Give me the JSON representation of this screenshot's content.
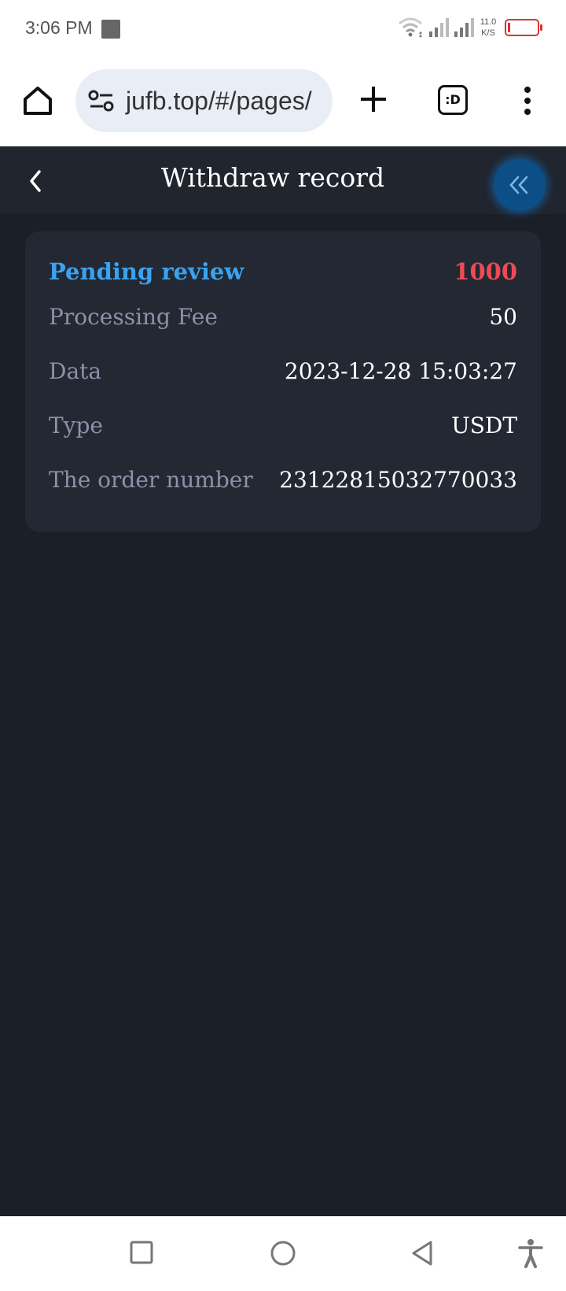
{
  "status_bar": {
    "time": "3:06 PM",
    "net_speed_value": "11.0",
    "net_speed_unit": "K/S",
    "icons": [
      "square-notification-icon",
      "wifi-icon",
      "signal-icon",
      "signal-icon",
      "battery-low-icon"
    ],
    "battery_color": "#dd3333"
  },
  "browser": {
    "url": "jufb.top/#/pages/",
    "tabs_label": ":D",
    "icons": [
      "home-icon",
      "site-settings-icon",
      "new-tab-icon",
      "tab-switcher-icon",
      "more-vert-icon"
    ]
  },
  "header": {
    "title": "Withdraw record",
    "back_icon": "chevron-left-icon",
    "float_icon": "double-chevron-left-icon",
    "float_color": "#0c4f86"
  },
  "record": {
    "status": "Pending review",
    "status_color": "#3aa3f0",
    "amount": "1000",
    "amount_color": "#ee4a53",
    "rows": [
      {
        "label": "Processing Fee",
        "value": "50"
      },
      {
        "label": "Data",
        "value": "2023-12-28 15:03:27"
      },
      {
        "label": "Type",
        "value": "USDT"
      },
      {
        "label": "The order number",
        "value": "23122815032770033"
      }
    ]
  },
  "nav": {
    "icons": [
      "recents-square-icon",
      "home-circle-icon",
      "back-triangle-icon",
      "accessibility-icon"
    ]
  },
  "colors": {
    "background": "#1b1f27",
    "card": "#232833",
    "header": "#20252e"
  }
}
